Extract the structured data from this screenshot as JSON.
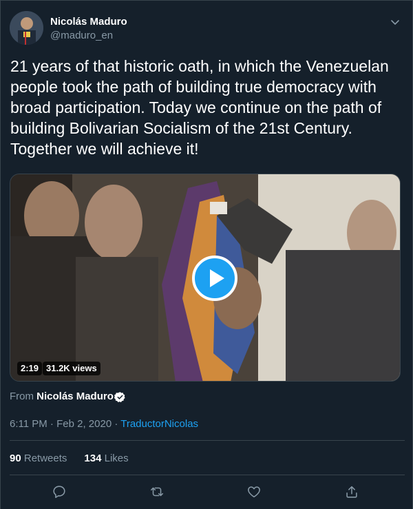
{
  "tweet": {
    "author_name": "Nicolás Maduro",
    "author_handle": "@maduro_en",
    "text": "21 years of that historic oath, in which the Venezuelan people took the path of building true democracy with broad participation. Today we continue on the path of building Bolivarian Socialism of the 21st Century. Together we will achieve it!",
    "media": {
      "duration": "2:19",
      "views": "31.2K views"
    },
    "from_prefix": "From",
    "from_name": "Nicolás Maduro",
    "time": "6:11 PM",
    "separator": " · ",
    "date": "Feb 2, 2020",
    "separator2": " · ",
    "source_app": "TraductorNicolas",
    "retweets_count": "90",
    "retweets_label": "Retweets",
    "likes_count": "134",
    "likes_label": "Likes"
  },
  "icons": {
    "more": "chevron-down-icon",
    "verified": "verified-badge-icon",
    "play": "play-icon",
    "reply": "reply-icon",
    "retweet": "retweet-icon",
    "like": "heart-icon",
    "share": "share-icon"
  },
  "colors": {
    "background": "#15202b",
    "border": "#38444d",
    "text_primary": "#ffffff",
    "text_secondary": "#8899a6",
    "accent": "#1da1f2"
  }
}
